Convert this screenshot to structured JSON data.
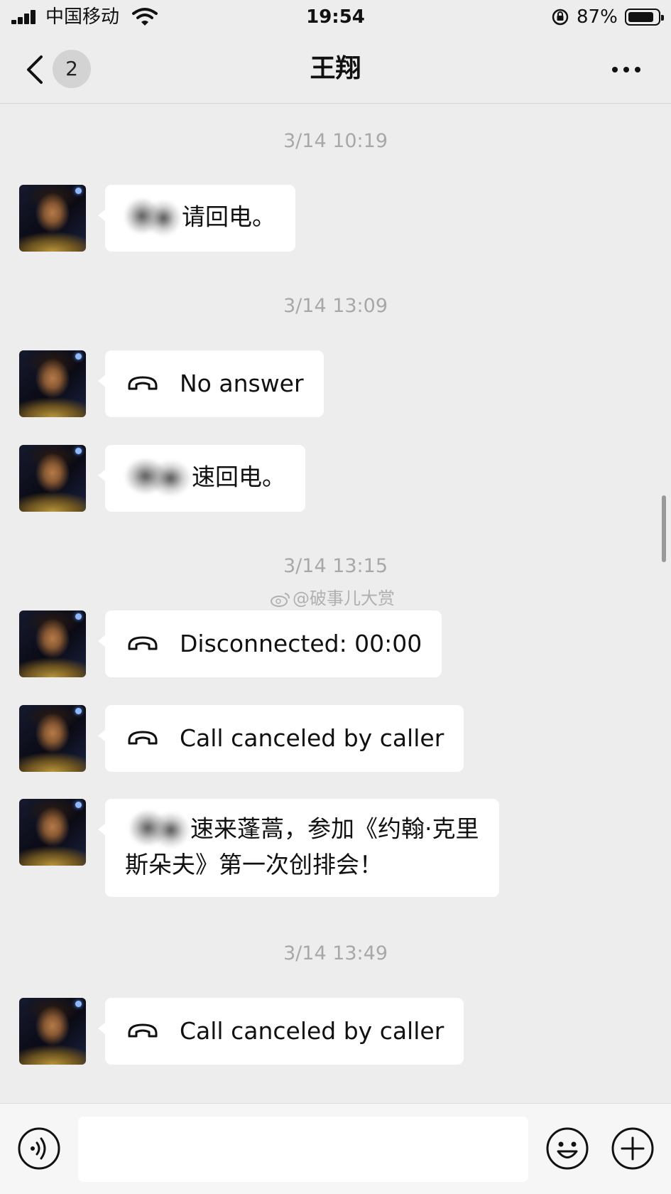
{
  "status_bar": {
    "carrier": "中国移动",
    "time": "19:54",
    "battery_percent": "87%",
    "battery_level": 0.87
  },
  "nav": {
    "unread_count": "2",
    "title": "王翔"
  },
  "messages": [
    {
      "type": "timestamp",
      "text": "3/14 10:19"
    },
    {
      "type": "text",
      "text": "请回电。",
      "redacted": true
    },
    {
      "type": "timestamp",
      "text": "3/14 13:09"
    },
    {
      "type": "call",
      "icon": "phone-hangup-icon",
      "text": "No answer"
    },
    {
      "type": "text",
      "text": "速回电。",
      "redacted": true
    },
    {
      "type": "timestamp",
      "text": "3/14 13:15"
    },
    {
      "type": "call",
      "icon": "phone-hangup-icon",
      "text": "Disconnected: 00:00"
    },
    {
      "type": "call",
      "icon": "phone-hangup-icon",
      "text": "Call canceled by caller"
    },
    {
      "type": "text",
      "line1": "速来蓬蒿，参加《约翰·克里",
      "line2": "斯朵夫》第一次创排会！",
      "redacted": true
    },
    {
      "type": "timestamp",
      "text": "3/14 13:49"
    },
    {
      "type": "call",
      "icon": "phone-hangup-icon",
      "text": "Call canceled by caller"
    }
  ],
  "watermark": "@破事儿大赏",
  "input_bar": {
    "voice_icon": "voice-icon",
    "emoji_icon": "emoji-icon",
    "plus_icon": "plus-icon",
    "value": ""
  },
  "colors": {
    "background": "#ededed",
    "bubble": "#ffffff",
    "timestamp": "#a8a8a8"
  }
}
